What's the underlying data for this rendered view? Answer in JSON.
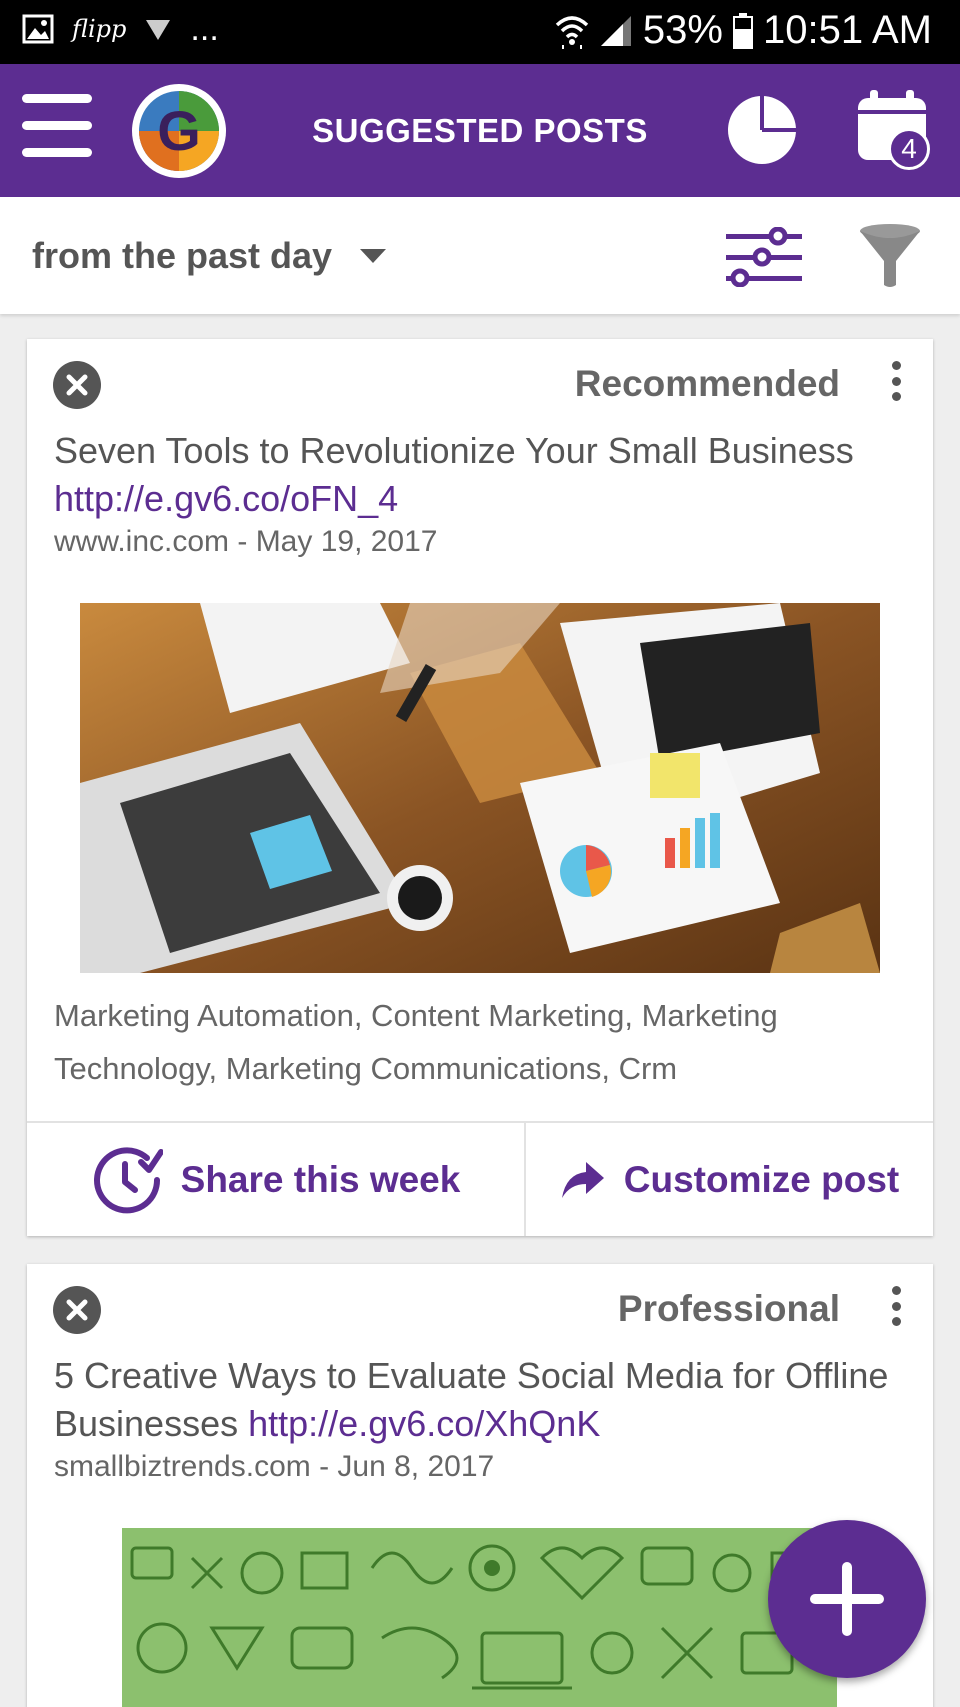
{
  "status_bar": {
    "app_label": "flipp",
    "more": "...",
    "battery": "53%",
    "time": "10:51 AM"
  },
  "app_bar": {
    "title": "SUGGESTED POSTS",
    "scheduled_count": "4"
  },
  "filter_bar": {
    "range": "from the past day"
  },
  "posts": [
    {
      "category": "Recommended",
      "title": "Seven Tools to Revolutionize Your Small Business",
      "link": "http://e.gv6.co/oFN_4",
      "source": "www.inc.com - May 19, 2017",
      "tags": "Marketing Automation, Content Marketing, Marketing Technology, Marketing Communications, Crm",
      "share_label": "Share this week",
      "customize_label": "Customize post"
    },
    {
      "category": "Professional",
      "title": "5 Creative Ways to Evaluate Social Media for Offline Businesses",
      "link": "http://e.gv6.co/XhQnK",
      "source": "smallbiztrends.com - Jun 8, 2017"
    }
  ],
  "colors": {
    "brand": "#5c2d91",
    "status_bar": "#000000",
    "background": "#eeeeee"
  },
  "icons": [
    "gallery-icon",
    "download-icon",
    "wifi-icon",
    "signal-icon",
    "battery-icon",
    "menu-icon",
    "app-logo",
    "pie-chart-icon",
    "calendar-icon",
    "sliders-icon",
    "funnel-icon",
    "close-icon",
    "more-vert-icon",
    "clock-check-icon",
    "share-arrow-icon",
    "plus-icon"
  ]
}
